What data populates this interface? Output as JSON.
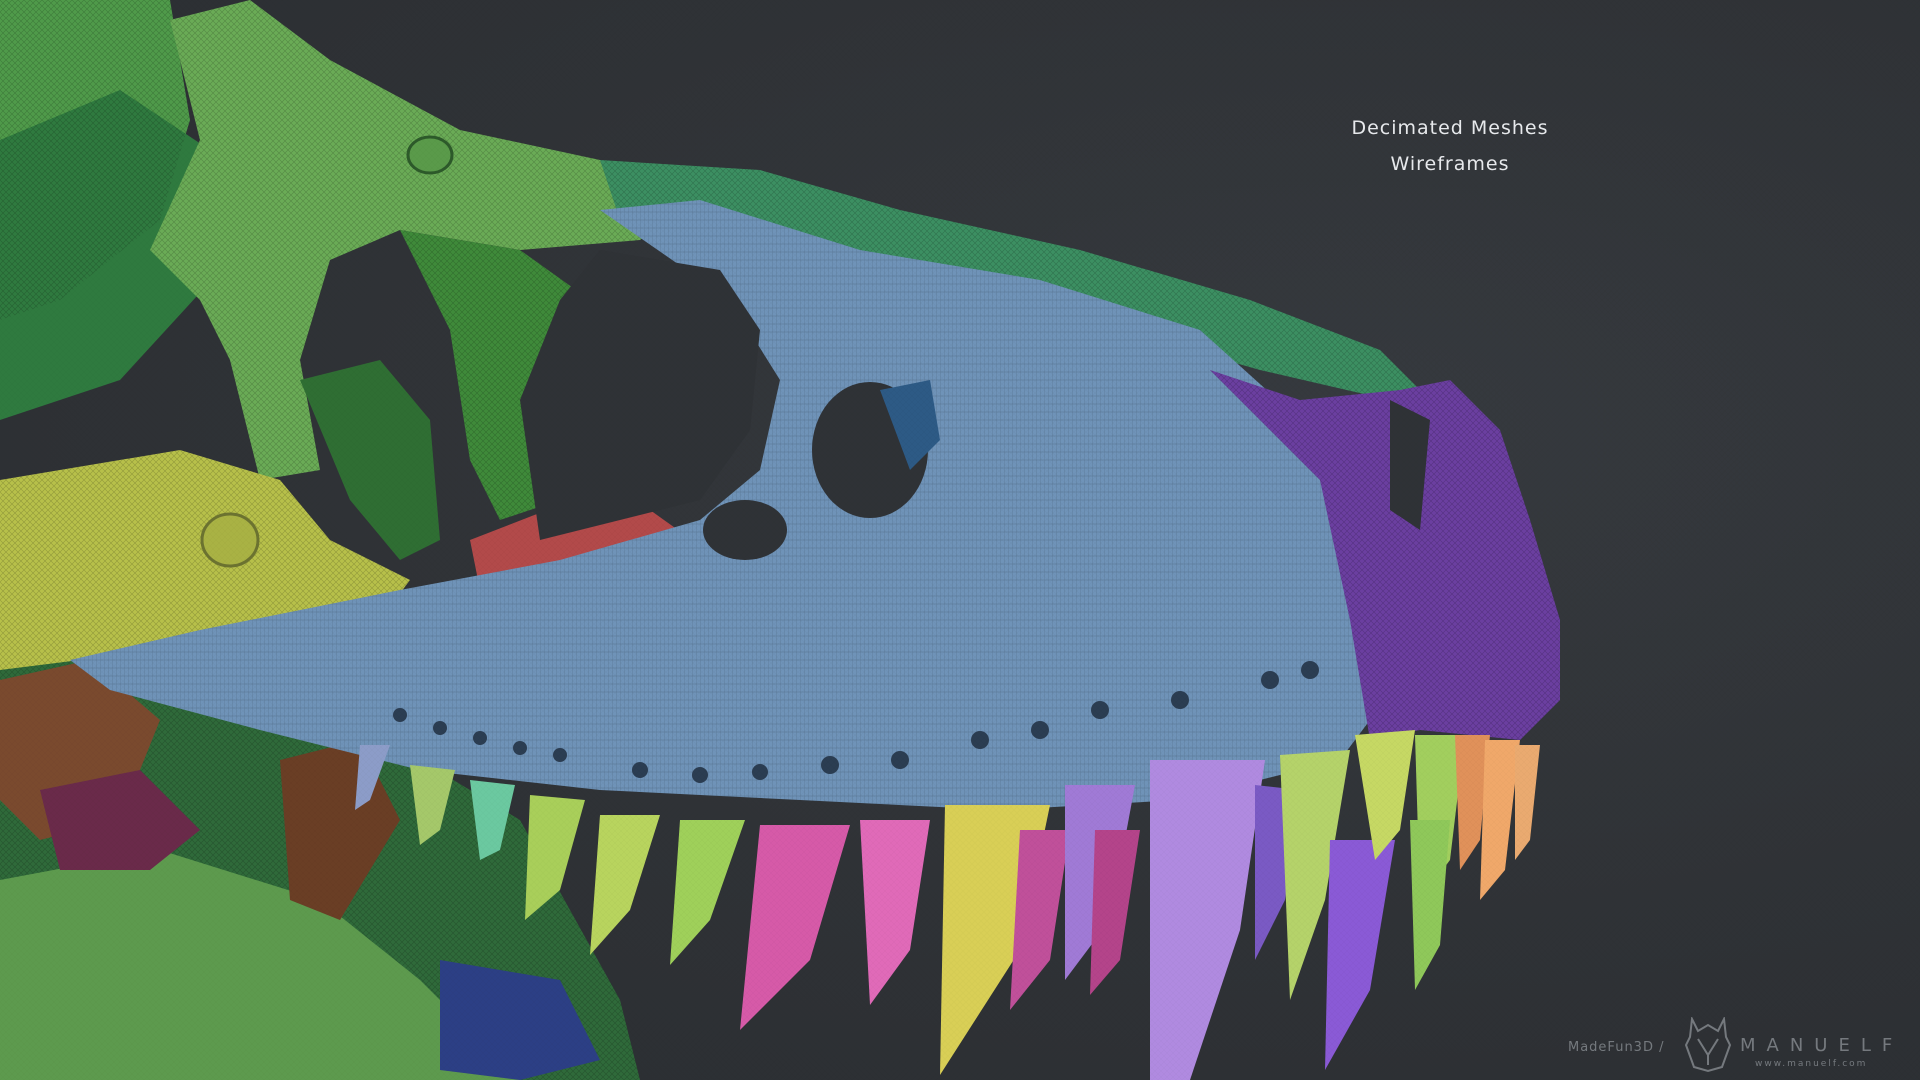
{
  "caption": {
    "line1": "Decimated Meshes",
    "line2": "Wireframes"
  },
  "watermark": {
    "studio": "MadeFun3D /",
    "brand": "MANUELF",
    "url": "www.manuelf.com"
  },
  "colors": {
    "background": "#2f3236",
    "maxilla_blue": "#6f93b8",
    "nasal_green": "#3f8f5f",
    "premaxilla_purple": "#6b3fa0",
    "jugal_yellow": "#b8c24a",
    "tooth_pink": "#d65aa8",
    "tooth_violet": "#a07ad6",
    "tooth_yellow": "#d9cf56",
    "tooth_lime": "#a9cf5a",
    "tooth_orange": "#e0915a"
  }
}
